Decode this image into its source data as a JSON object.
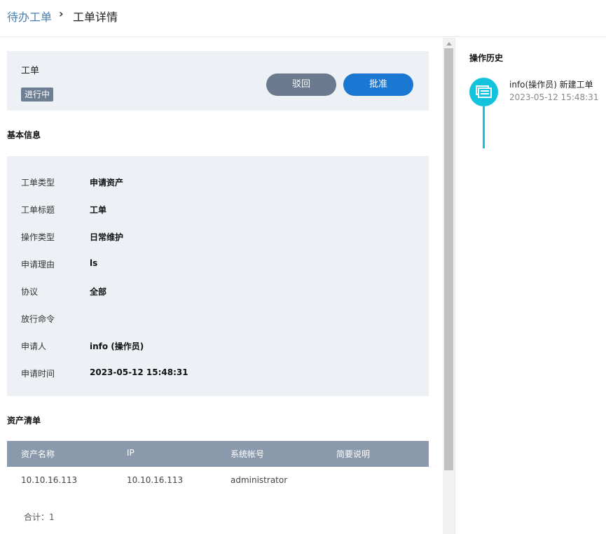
{
  "breadcrumb": {
    "parent": "待办工单",
    "separator": "›",
    "current": "工单详情"
  },
  "ticket": {
    "title": "工单",
    "status": "进行中",
    "reject_label": "驳回",
    "approve_label": "批准"
  },
  "basic_info": {
    "section_title": "基本信息",
    "rows": [
      {
        "label": "工单类型",
        "value": "申请资产"
      },
      {
        "label": "工单标题",
        "value": "工单"
      },
      {
        "label": "操作类型",
        "value": "日常维护"
      },
      {
        "label": "申请理由",
        "value": "ls"
      },
      {
        "label": "协议",
        "value": "全部"
      },
      {
        "label": "放行命令",
        "value": ""
      },
      {
        "label": "申请人",
        "value": "info (操作员)"
      },
      {
        "label": "申请时间",
        "value": "2023-05-12 15:48:31"
      }
    ]
  },
  "assets": {
    "section_title": "资产清单",
    "columns": [
      "资产名称",
      "IP",
      "系统帐号",
      "简要说明"
    ],
    "rows": [
      [
        "10.10.16.113",
        "10.10.16.113",
        "administrator",
        ""
      ]
    ],
    "total": "合计：1"
  },
  "history": {
    "title": "操作历史",
    "items": [
      {
        "text": "info(操作员) 新建工单",
        "time": "2023-05-12 15:48:31",
        "icon": "message-icon"
      }
    ]
  },
  "colors": {
    "accent": "#1a77d2",
    "reject": "#6b7a8f",
    "timeline": "#13c3dd",
    "panel_bg": "#edf1f6",
    "table_header": "#8a99ab"
  }
}
